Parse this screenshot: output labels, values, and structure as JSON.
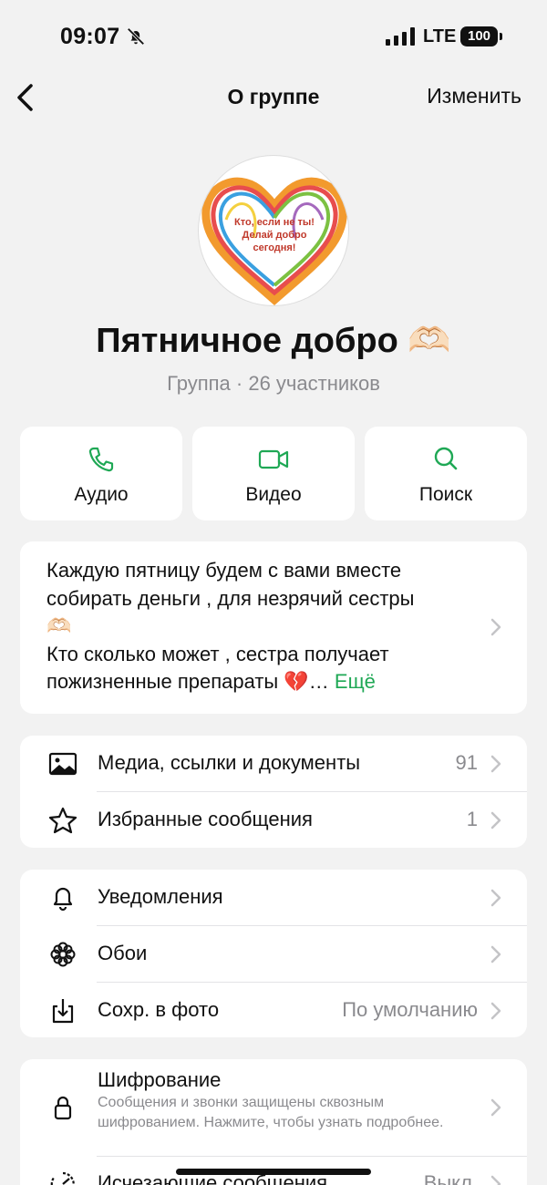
{
  "status_bar": {
    "time": "09:07",
    "network": "LTE",
    "battery": "100"
  },
  "nav": {
    "title": "О группе",
    "edit": "Изменить"
  },
  "avatar": {
    "line1": "Кто, если не ты!",
    "line2": "Делай добро",
    "line3": "сегодня!"
  },
  "group": {
    "name": "Пятничное добро 🫶🏻",
    "subtitle": "Группа · 26 участников"
  },
  "actions": [
    {
      "label": "Аудио",
      "icon": "phone-icon"
    },
    {
      "label": "Видео",
      "icon": "video-icon"
    },
    {
      "label": "Поиск",
      "icon": "search-icon"
    }
  ],
  "description": {
    "line1": "Каждую пятницу будем с вами вместе собирать деньги , для незрячий сестры",
    "emoji": "🫶🏻",
    "line2": "Кто сколько может , сестра получает пожизненные препараты 💔…",
    "more": "Ещё"
  },
  "media_section": [
    {
      "label": "Медиа, ссылки и документы",
      "value": "91",
      "icon": "photo-icon"
    },
    {
      "label": "Избранные сообщения",
      "value": "1",
      "icon": "star-icon"
    }
  ],
  "settings_section": [
    {
      "label": "Уведомления",
      "value": "",
      "icon": "bell-icon"
    },
    {
      "label": "Обои",
      "value": "",
      "icon": "flower-icon"
    },
    {
      "label": "Сохр. в фото",
      "value": "По умолчанию",
      "icon": "download-icon"
    }
  ],
  "privacy_section": {
    "encryption": {
      "title": "Шифрование",
      "description": "Сообщения и звонки защищены сквозным шифрованием. Нажмите, чтобы узнать подробнее."
    },
    "disappearing": {
      "label": "Исчезающие сообщения",
      "value": "Выкл."
    }
  },
  "colors": {
    "accent": "#1fa855",
    "background": "#f2f2f2",
    "card": "#ffffff",
    "secondary_text": "#8a8a8e"
  }
}
